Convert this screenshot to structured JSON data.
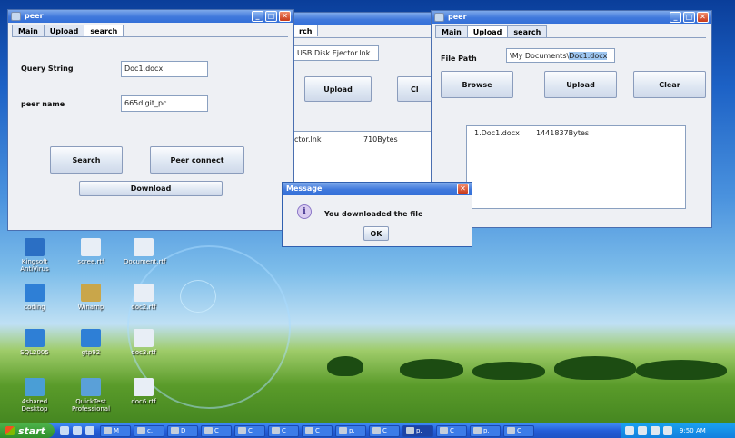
{
  "colors": {
    "accent": "#3f78dc",
    "desktop": "#1d62c6"
  },
  "win_left": {
    "title": "peer",
    "tabs": [
      "Main",
      "Upload",
      "search"
    ],
    "query_label": "Query String",
    "query_value": "Doc1.docx",
    "peer_label": "peer name",
    "peer_value": "665digit_pc",
    "search_btn": "Search",
    "peer_connect_btn": "Peer connect",
    "download_btn": "Download"
  },
  "win_mid": {
    "tab_fragment": "rch",
    "path_value": "USB Disk Ejector.lnk",
    "upload_btn": "Upload",
    "clear_fragment": "Cl",
    "list_name": "ctor.lnk",
    "list_size": "710Bytes"
  },
  "win_right": {
    "title": "peer",
    "tabs": [
      "Main",
      "Upload",
      "search"
    ],
    "path_label": "File Path",
    "path_prefix": "\\My Documents\\",
    "path_selected": "Doc1.docx",
    "browse_btn": "Browse",
    "upload_btn": "Upload",
    "clear_btn": "Clear",
    "list_item": "1.Doc1.docx",
    "list_size": "1441837Bytes"
  },
  "dialog": {
    "title": "Message",
    "message": "You downloaded the file",
    "ok": "OK",
    "icon": "info-icon"
  },
  "desktop_icons": [
    "Kingsoft AntiVirus",
    "scree.rtf",
    "Document.rtf",
    "coding",
    "Winamp",
    "doc2.rtf",
    "SQL2005",
    "gtp92",
    "doc3.rtf",
    "4shared Desktop",
    "QuickTest Professional",
    "doc6.rtf"
  ],
  "taskbar": {
    "start": "start",
    "items": [
      "M",
      "c.",
      "D",
      "C",
      "C",
      "C",
      "C",
      "p.",
      "C",
      "p.",
      "C",
      "p.",
      "C"
    ],
    "clock": "9:50 AM"
  }
}
